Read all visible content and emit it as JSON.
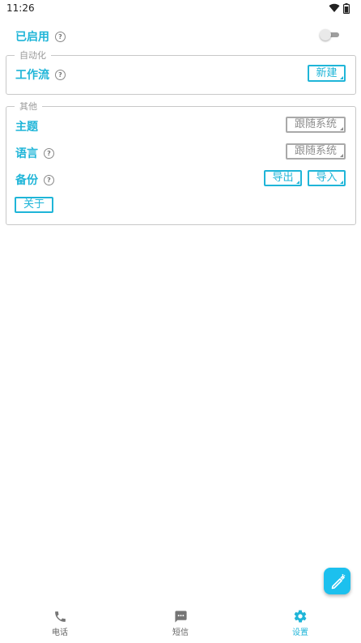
{
  "status_bar": {
    "time": "11:26",
    "icons": [
      "wifi-icon",
      "battery-icon"
    ]
  },
  "enabled": {
    "label": "已启用",
    "help_glyph": "?",
    "toggle_on": false
  },
  "automation": {
    "legend": "自动化",
    "workflow": {
      "label": "工作流",
      "help_glyph": "?",
      "button": "新建"
    }
  },
  "other": {
    "legend": "其他",
    "theme": {
      "label": "主题",
      "value": "跟随系统"
    },
    "language": {
      "label": "语言",
      "help_glyph": "?",
      "value": "跟随系统"
    },
    "backup": {
      "label": "备份",
      "help_glyph": "?",
      "export": "导出",
      "import": "导入"
    },
    "about": "关于"
  },
  "fab": {
    "icon": "edit-icon"
  },
  "bottom_nav": {
    "items": [
      {
        "label": "电话",
        "icon": "phone-icon"
      },
      {
        "label": "短信",
        "icon": "message-icon"
      },
      {
        "label": "设置",
        "icon": "gear-icon"
      }
    ],
    "active_index": 2
  },
  "colors": {
    "accent": "#1fb5d8",
    "muted": "#a9a9a9",
    "fab": "#1cc0ee"
  }
}
